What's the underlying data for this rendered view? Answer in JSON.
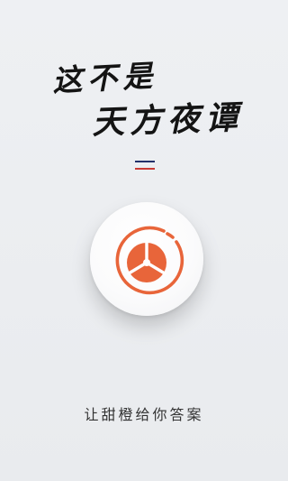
{
  "splash": {
    "headline_line_1": "这不是",
    "headline_line_2": "天方夜谭",
    "tagline": "让甜橙给你答案"
  },
  "colors": {
    "background": "#eceef1",
    "headline": "#141414",
    "divider_top": "#22306a",
    "divider_bottom": "#c93a34",
    "logo_orange": "#e8653a",
    "tagline": "#333333"
  },
  "icons": {
    "logo": "orange-slice-logo-icon",
    "divider": "double-line-divider-icon"
  }
}
